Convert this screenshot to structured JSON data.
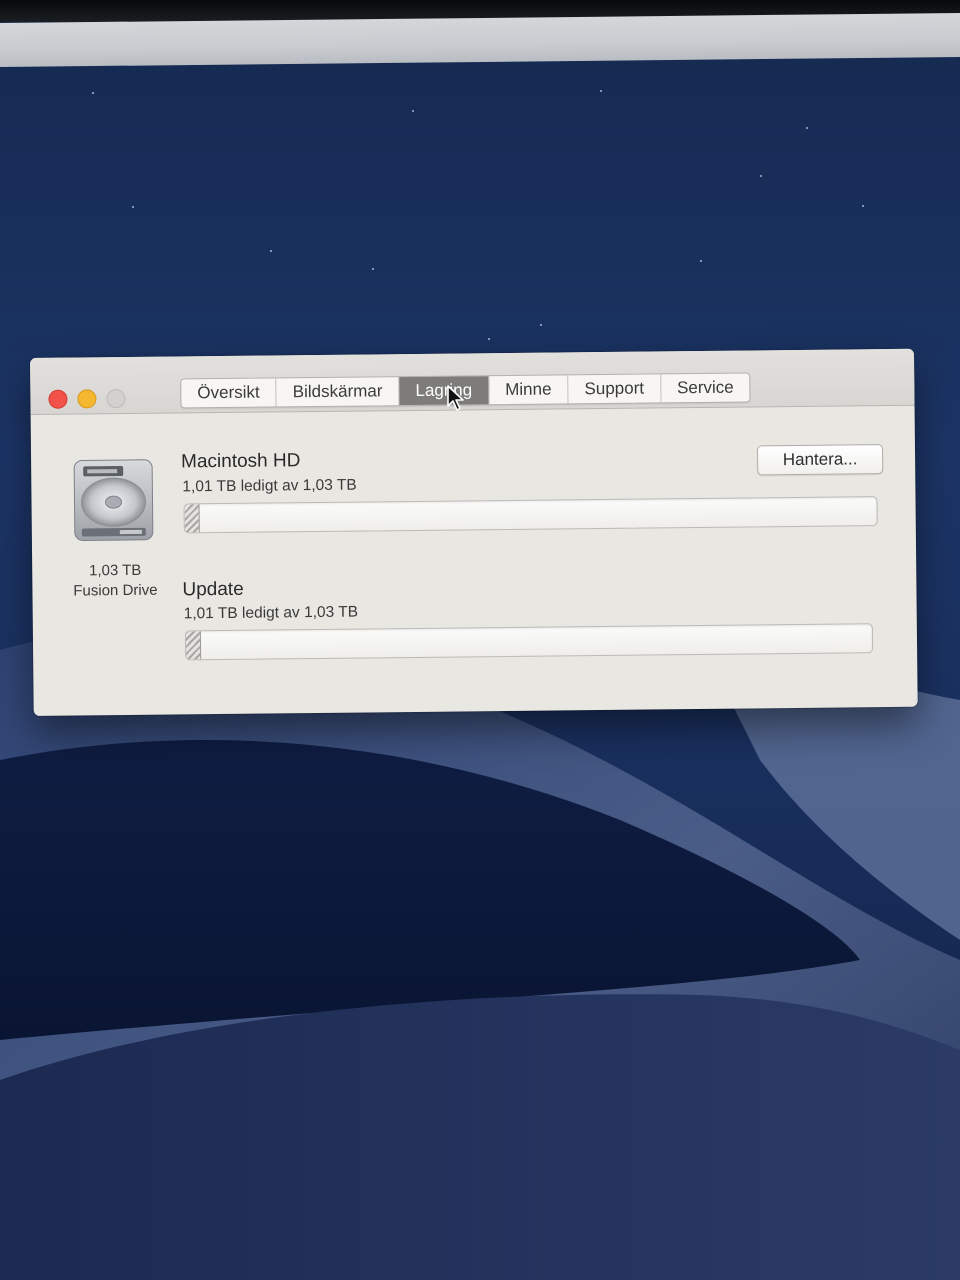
{
  "window": {
    "tabs": [
      {
        "label": "Översikt"
      },
      {
        "label": "Bildskärmar"
      },
      {
        "label": "Lagring"
      },
      {
        "label": "Minne"
      },
      {
        "label": "Support"
      },
      {
        "label": "Service"
      }
    ],
    "active_tab": "Lagring"
  },
  "drive": {
    "icon": "hard-drive-icon",
    "size": "1,03 TB",
    "type": "Fusion Drive"
  },
  "volumes": [
    {
      "name": "Macintosh HD",
      "free_text": "1,01 TB ledigt av 1,03 TB",
      "used_fraction": 0.02
    },
    {
      "name": "Update",
      "free_text": "1,01 TB ledigt av 1,03 TB",
      "used_fraction": 0.02
    }
  ],
  "manage_button": {
    "label": "Hantera..."
  },
  "colors": {
    "close": "#f2524a",
    "minimize": "#f5b730",
    "zoom": "#d3d1cd",
    "active_tab": "#7d7c7a"
  }
}
